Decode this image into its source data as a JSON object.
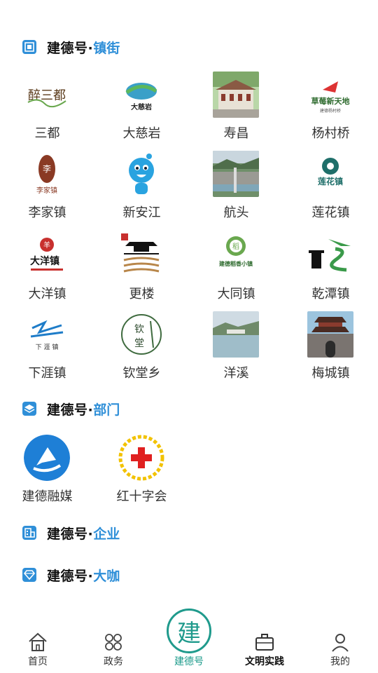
{
  "sections": {
    "towns": {
      "title": "建德号·",
      "sub": "镇街",
      "icon": "grid-icon"
    },
    "depts": {
      "title": "建德号·",
      "sub": "部门",
      "icon": "layers-icon"
    },
    "enterprise": {
      "title": "建德号·",
      "sub": "企业",
      "icon": "building-icon"
    },
    "bigshot": {
      "title": "建德号·",
      "sub": "大咖",
      "icon": "diamond-icon"
    }
  },
  "towns": [
    {
      "label": "三都",
      "logo_text": "醉三都"
    },
    {
      "label": "大慈岩",
      "logo_text": "大慈岩"
    },
    {
      "label": "寿昌"
    },
    {
      "label": "杨村桥",
      "logo_text": "草莓新天地",
      "logo_sub": "建德杨村桥"
    },
    {
      "label": "李家镇",
      "logo_text": "李家镇"
    },
    {
      "label": "新安江"
    },
    {
      "label": "航头"
    },
    {
      "label": "莲花镇",
      "logo_text": "莲花镇"
    },
    {
      "label": "大洋镇",
      "logo_text": "大洋镇"
    },
    {
      "label": "更楼"
    },
    {
      "label": "大同镇",
      "logo_text": "建德稻香小镇"
    },
    {
      "label": "乾潭镇"
    },
    {
      "label": "下涯镇",
      "logo_text": "下 涯 镇"
    },
    {
      "label": "钦堂乡",
      "logo_text": "钦堂"
    },
    {
      "label": "洋溪"
    },
    {
      "label": "梅城镇"
    }
  ],
  "departments": [
    {
      "label": "建德融媒"
    },
    {
      "label": "红十字会"
    }
  ],
  "nav": {
    "items": [
      {
        "label": "首页",
        "icon": "home-icon"
      },
      {
        "label": "政务",
        "icon": "apps-icon"
      },
      {
        "label": "建德号",
        "icon": "jian-logo-icon"
      },
      {
        "label": "文明实践",
        "icon": "briefcase-icon"
      },
      {
        "label": "我的",
        "icon": "user-icon"
      }
    ],
    "center_glyph": "建"
  },
  "colors": {
    "accent": "#2f8fd8",
    "nav_active": "#1a9a8a"
  }
}
